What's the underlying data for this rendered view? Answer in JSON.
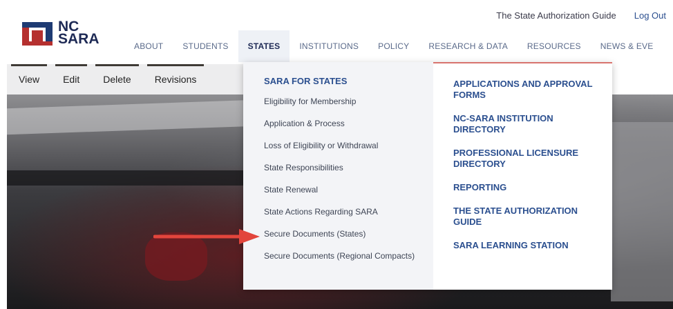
{
  "utility": {
    "guide_link": "The State Authorization Guide",
    "logout_link": "Log Out"
  },
  "logo": {
    "line1": "NC",
    "line2": "SARA"
  },
  "nav": {
    "items": [
      {
        "label": "ABOUT"
      },
      {
        "label": "STUDENTS"
      },
      {
        "label": "STATES"
      },
      {
        "label": "INSTITUTIONS"
      },
      {
        "label": "POLICY"
      },
      {
        "label": "RESEARCH & DATA"
      },
      {
        "label": "RESOURCES"
      },
      {
        "label": "NEWS & EVE"
      }
    ]
  },
  "tabs": [
    {
      "label": "View"
    },
    {
      "label": "Edit"
    },
    {
      "label": "Delete"
    },
    {
      "label": "Revisions"
    }
  ],
  "dropdown": {
    "heading": "SARA FOR STATES",
    "left_links": [
      "Eligibility for Membership",
      "Application & Process",
      "Loss of Eligibility or Withdrawal",
      "State Responsibilities",
      "State Renewal",
      "State Actions Regarding SARA",
      "Secure Documents (States)",
      "Secure Documents (Regional Compacts)"
    ],
    "right_links": [
      "APPLICATIONS AND APPROVAL FORMS",
      "NC-SARA INSTITUTION DIRECTORY",
      "PROFESSIONAL LICENSURE DIRECTORY",
      "REPORTING",
      "THE STATE AUTHORIZATION GUIDE",
      "SARA LEARNING STATION"
    ]
  },
  "colors": {
    "brand_navy": "#1e3b73",
    "brand_red": "#b5302f",
    "link_blue": "#2b4f8f",
    "arrow_red": "#e2453c"
  }
}
